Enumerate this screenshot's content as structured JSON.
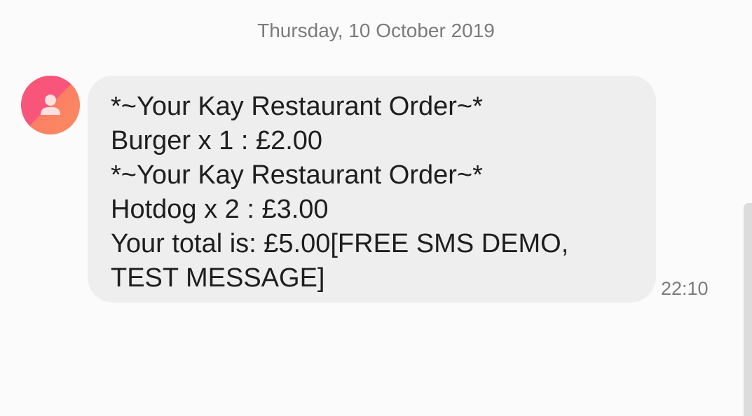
{
  "conversation": {
    "date_header": "Thursday, 10 October 2019"
  },
  "message": {
    "avatar_icon": "person-icon",
    "lines": [
      "*~Your Kay Restaurant Order~*",
      "Burger x 1 : £2.00",
      "*~Your Kay Restaurant Order~*",
      "Hotdog x 2 : £3.00",
      "Your total is: £5.00[FREE SMS DEMO,",
      "TEST MESSAGE]"
    ],
    "time": "22:10"
  },
  "colors": {
    "background": "#fbfbfb",
    "bubble": "#eeeeee",
    "avatar_gradient_start": "#f9557a",
    "avatar_gradient_end": "#fb8c62",
    "secondary_text": "#7b7b7b",
    "message_text": "#1e1e1e"
  }
}
